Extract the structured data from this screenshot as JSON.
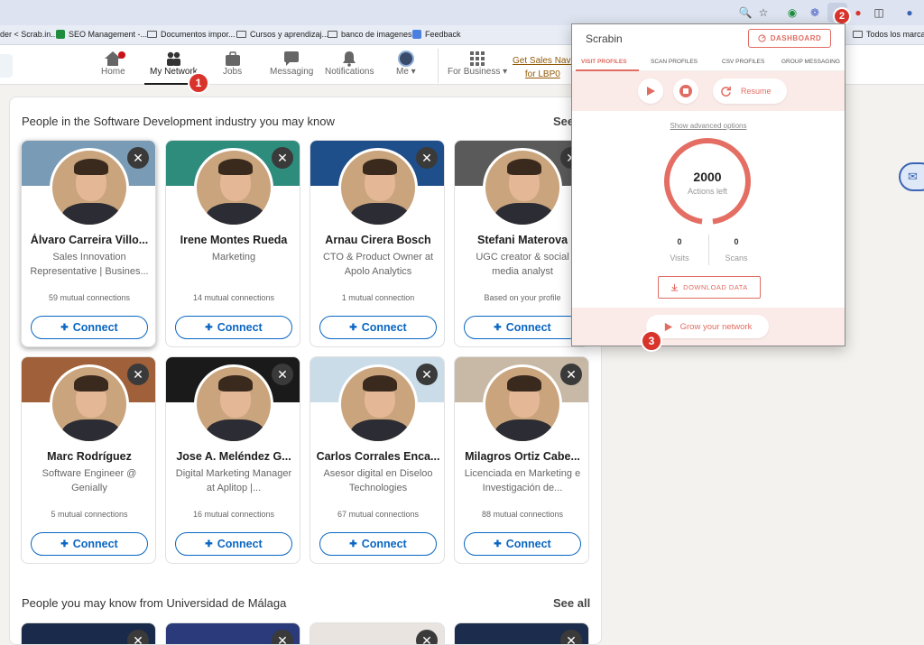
{
  "bookmarks": [
    {
      "label": "der < Scrab.in..."
    },
    {
      "label": "SEO Management -..."
    },
    {
      "label": "Documentos impor..."
    },
    {
      "label": "Cursos y aprendizaj..."
    },
    {
      "label": "banco de imagenes"
    },
    {
      "label": "Feedback"
    },
    {
      "label": "Todos los marcado"
    }
  ],
  "nav": {
    "home": "Home",
    "network": "My Network",
    "jobs": "Jobs",
    "messaging": "Messaging",
    "notifications": "Notifications",
    "me": "Me",
    "business": "For Business",
    "sales_line1": "Get Sales Navi",
    "sales_line2": "for LBP0"
  },
  "steps": {
    "one": "1",
    "two": "2",
    "three": "3"
  },
  "section1": {
    "title": "People in the Software Development industry you may know",
    "see_all": "See"
  },
  "section2": {
    "title": "People you may know from Universidad de Málaga",
    "see_all": "See all"
  },
  "connect_label": "Connect",
  "people": [
    {
      "name": "Álvaro Carreira Villo...",
      "headline": "Sales Innovation Representative | Busines...",
      "mutual": "59 mutual connections",
      "cover": "#7a9bb5"
    },
    {
      "name": "Irene Montes Rueda",
      "headline": "Marketing",
      "mutual": "14 mutual connections",
      "cover": "#2e8c7d"
    },
    {
      "name": "Arnau Cirera Bosch",
      "headline": "CTO & Product Owner at Apolo Analytics",
      "mutual": "1 mutual connection",
      "cover": "#1f4f8a"
    },
    {
      "name": "Stefani Materova",
      "headline": "UGC creator & social media analyst",
      "mutual": "Based on your profile",
      "cover": "#5a5a5a"
    },
    {
      "name": "Marc Rodríguez",
      "headline": "Software Engineer @ Genially",
      "mutual": "5 mutual connections",
      "cover": "#a0603a"
    },
    {
      "name": "Jose A. Meléndez G...",
      "headline": "Digital Marketing Manager at Aplitop |...",
      "mutual": "16 mutual connections",
      "cover": "#1a1a1a"
    },
    {
      "name": "Carlos Corrales Enca...",
      "headline": "Asesor digital en Diseloo Technologies",
      "mutual": "67 mutual connections",
      "cover": "#c9dce8"
    },
    {
      "name": "Milagros Ortiz Cabe...",
      "headline": "Licenciada en Marketing e Investigación de...",
      "mutual": "88 mutual connections",
      "cover": "#c8b8a6"
    }
  ],
  "scrabin": {
    "title": "Scrabin",
    "dashboard": "DASHBOARD",
    "tabs": [
      "VISIT PROFILES",
      "SCAN PROFILES",
      "CSV PROFILES",
      "GROUP MESSAGING"
    ],
    "resume": "Resume",
    "advanced": "Show advanced options",
    "actions": "2000",
    "actions_label": "Actions left",
    "visits": "0",
    "visits_label": "Visits",
    "scans": "0",
    "scans_label": "Scans",
    "download": "DOWNLOAD DATA",
    "grow": "Grow your network",
    "accent": "#e06c62"
  }
}
